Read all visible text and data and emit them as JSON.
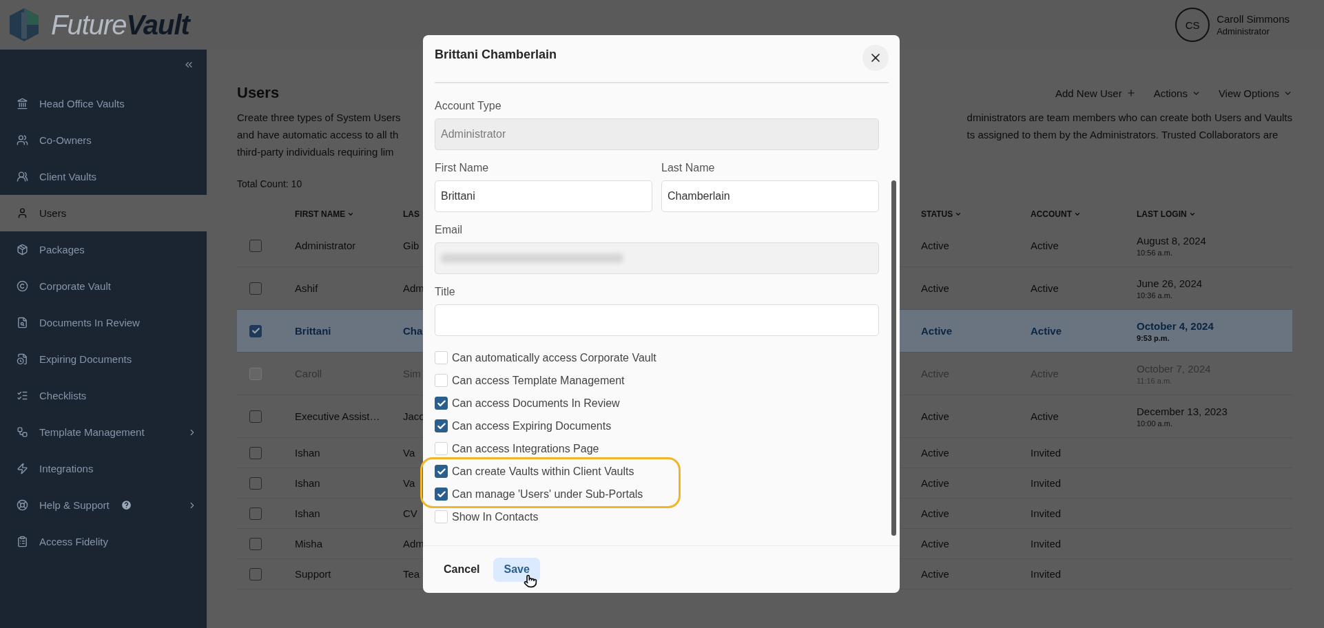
{
  "brand": {
    "logo": "Future**Vault**"
  },
  "user": {
    "initials": "CS",
    "name": "Caroll Simmons",
    "role": "Administrator"
  },
  "sidebar": {
    "items": [
      {
        "label": "Head Office Vaults",
        "selected": false
      },
      {
        "label": "Co-Owners",
        "selected": false
      },
      {
        "label": "Client Vaults",
        "selected": false
      },
      {
        "label": "Users",
        "selected": true
      },
      {
        "label": "Packages",
        "selected": false
      },
      {
        "label": "Corporate Vault",
        "selected": false
      },
      {
        "label": "Documents In Review",
        "selected": false
      },
      {
        "label": "Expiring Documents",
        "selected": false
      },
      {
        "label": "Checklists",
        "selected": false
      },
      {
        "label": "Template Management",
        "selected": false,
        "expandable": true
      },
      {
        "label": "Integrations",
        "selected": false
      },
      {
        "label": "Help & Support",
        "selected": false,
        "expandable": true,
        "badge": true
      },
      {
        "label": "Access Fidelity",
        "selected": false
      }
    ]
  },
  "page": {
    "title": "Users",
    "toolbar": [
      {
        "label": "Add New User",
        "kind": "add"
      },
      {
        "label": "Actions",
        "kind": "menu"
      },
      {
        "label": "View Options",
        "kind": "menu"
      }
    ],
    "description_left": [
      "Create three types of System Users",
      "and have automatic access to all th",
      "third-party individuals requiring lim"
    ],
    "description_right": [
      "dministrators are team members who can create both Users and Vaults",
      "ts assigned to them by the Administrators. Trusted Collaborators are"
    ],
    "total_count": "Total Count: 10"
  },
  "table": {
    "columns": [
      {
        "label": "FIRST NAME"
      },
      {
        "label": "LAS"
      },
      {
        "label": "STATUS"
      },
      {
        "label": "ACCOUNT"
      },
      {
        "label": "LAST LOGIN"
      }
    ],
    "rows": [
      {
        "first_name": "Administrator",
        "last_name": "Gib",
        "status": "Active",
        "account": "Active",
        "last_login": "August 8, 2024",
        "login_time": "10:56 a.m.",
        "checked": false,
        "selected": false,
        "disabled": false
      },
      {
        "first_name": "Ashif",
        "last_name": "Adm",
        "status": "Active",
        "account": "Active",
        "last_login": "June 26, 2024",
        "login_time": "10:36 a.m.",
        "checked": false,
        "selected": false,
        "disabled": false
      },
      {
        "first_name": "Brittani",
        "last_name": "Cha",
        "status": "Active",
        "account": "Active",
        "last_login": "October 4, 2024",
        "login_time": "9:53 p.m.",
        "checked": true,
        "selected": true,
        "disabled": false
      },
      {
        "first_name": "Caroll",
        "last_name": "Sim",
        "status": "Active",
        "account": "Active",
        "last_login": "October 7, 2024",
        "login_time": "11:16 a.m.",
        "checked": false,
        "selected": false,
        "disabled": true
      },
      {
        "first_name": "Executive Assist…",
        "last_name": "Jaco",
        "status": "Active",
        "account": "Active",
        "last_login": "December 13, 2023",
        "login_time": "10:00 a.m.",
        "checked": false,
        "selected": false,
        "disabled": false
      },
      {
        "first_name": "Ishan",
        "last_name": "Va",
        "status": "Active",
        "account": "Invited",
        "checked": false,
        "selected": false,
        "disabled": false
      },
      {
        "first_name": "Ishan",
        "last_name": "Va",
        "status": "Active",
        "account": "Invited",
        "checked": false,
        "selected": false,
        "disabled": false
      },
      {
        "first_name": "Ishan",
        "last_name": "CV",
        "status": "Active",
        "account": "Invited",
        "checked": false,
        "selected": false,
        "disabled": false
      },
      {
        "first_name": "Misha",
        "last_name": "Adm",
        "status": "Active",
        "account": "Invited",
        "checked": false,
        "selected": false,
        "disabled": false
      },
      {
        "first_name": "Support",
        "last_name": "Tea",
        "status": "Active",
        "account": "Invited",
        "checked": false,
        "selected": false,
        "disabled": false
      }
    ]
  },
  "modal": {
    "title": "Brittani Chamberlain",
    "field_rows": [
      [
        {
          "label": "Account Type",
          "kind": "text",
          "value": "Administrator",
          "disabled": true
        }
      ],
      [
        {
          "label": "First Name",
          "kind": "text",
          "value": "Brittani",
          "disabled": false
        },
        {
          "label": "Last Name",
          "kind": "text",
          "value": "Chamberlain",
          "disabled": false
        }
      ],
      [
        {
          "label": "Email",
          "kind": "redacted",
          "disabled": false
        }
      ],
      [
        {
          "label": "Title",
          "kind": "text",
          "disabled": false
        }
      ]
    ],
    "permissions": [
      {
        "label": "Can automatically access Corporate Vault",
        "checked": false,
        "highlighted": false
      },
      {
        "label": "Can access Template Management",
        "checked": false,
        "highlighted": false
      },
      {
        "label": "Can access Documents In Review",
        "checked": true,
        "highlighted": false
      },
      {
        "label": "Can access Expiring Documents",
        "checked": true,
        "highlighted": false
      },
      {
        "label": "Can access Integrations Page",
        "checked": false,
        "highlighted": false
      },
      {
        "label": "Can create Vaults within Client Vaults",
        "checked": true,
        "highlighted": true
      },
      {
        "label": "Can manage 'Users' under Sub-Portals",
        "checked": true,
        "highlighted": true
      },
      {
        "label": "Show In Contacts",
        "checked": false,
        "highlighted": false
      }
    ],
    "cancel": "Cancel",
    "save": "Save"
  }
}
